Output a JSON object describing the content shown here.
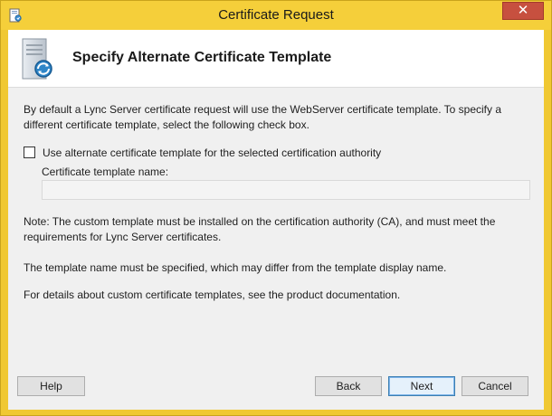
{
  "window": {
    "title": "Certificate Request",
    "close_label": "✕"
  },
  "header": {
    "heading": "Specify Alternate Certificate Template"
  },
  "content": {
    "intro": "By default a Lync Server certificate request will use the WebServer certificate template. To specify a different certificate template, select the following check box.",
    "checkbox_label": "Use alternate certificate template for the selected certification authority",
    "checkbox_checked": false,
    "field_label": "Certificate template name:",
    "field_value": "",
    "note": "Note: The custom template must be installed on the certification authority (CA), and must meet the requirements for Lync Server certificates.",
    "template_name_info": "The template name must be specified, which may differ from the template display name.",
    "details_info": "For details about custom certificate templates, see the product documentation."
  },
  "buttons": {
    "help": "Help",
    "back": "Back",
    "next": "Next",
    "cancel": "Cancel"
  },
  "icons": {
    "window_icon": "certificate-app-icon",
    "header_icon": "server-certificate-icon"
  },
  "colors": {
    "titlebar": "#f5cf3a",
    "close_button": "#c7503f",
    "client_background": "#f0f0f0"
  }
}
